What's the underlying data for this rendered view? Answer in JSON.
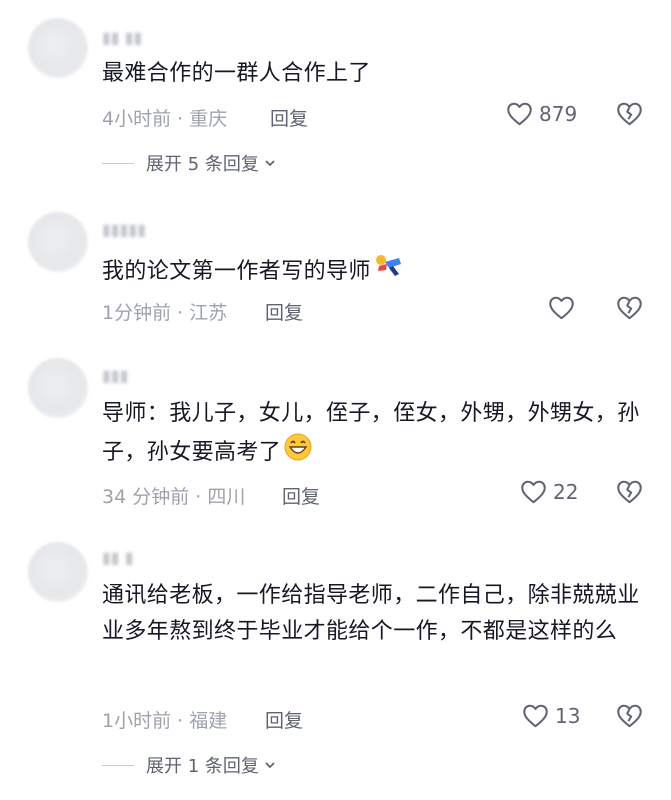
{
  "colors": {
    "text_primary": "#161823",
    "text_secondary": "#9ea3ab",
    "action_gray": "#5f6470",
    "background": "#ffffff"
  },
  "comments": [
    {
      "text": "最难合作的一群人合作上了",
      "meta": "4小时前 · 重庆",
      "reply_label": "回复",
      "likes": "879",
      "expand_label": "展开 5 条回复"
    },
    {
      "text": "我的论文第一作者写的导师",
      "emoji": "falling-person-emoji",
      "meta": "1分钟前 · 江苏",
      "reply_label": "回复",
      "likes": ""
    },
    {
      "text": "导师：我儿子，女儿，侄子，侄女，外甥，外甥女，孙子，孙女要高考了",
      "emoji": "grinning-face-emoji",
      "meta": "34 分钟前 · 四川",
      "reply_label": "回复",
      "likes": "22"
    },
    {
      "text": "通讯给老板，一作给指导老师，二作自己，除非兢兢业业多年熬到终于毕业才能给个一作，不都是这样的么",
      "meta": "1小时前 · 福建",
      "reply_label": "回复",
      "likes": "13",
      "expand_label": "展开 1 条回复"
    }
  ]
}
